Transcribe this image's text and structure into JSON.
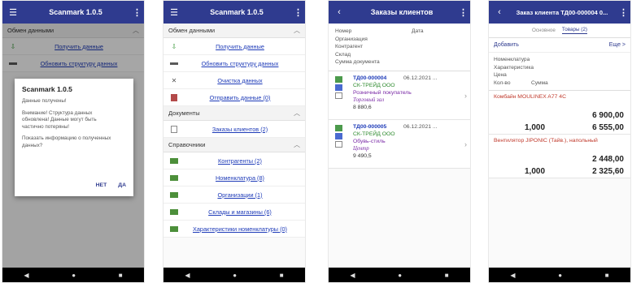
{
  "phone1": {
    "title": "Scanmark 1.0.5",
    "section": "Обмен данными",
    "rows": [
      {
        "label": "Получить данные"
      },
      {
        "label": "Обновить структуру данных"
      }
    ],
    "dialog": {
      "title": "Scanmark 1.0.5",
      "line1": "Данные получены!",
      "line2": "Внимание! Структура данных\nобновлена! Данные могут быть\nчастично потеряны!",
      "line3": "Показать информацию о полученных\nданных?",
      "no": "НЕТ",
      "yes": "ДА"
    }
  },
  "phone2": {
    "title": "Scanmark 1.0.5",
    "sections": [
      {
        "label": "Обмен данными",
        "items": [
          "Получить данные",
          "Обновить структуру данных",
          "Очистка данных",
          "Отправить данные (0)"
        ]
      },
      {
        "label": "Документы",
        "items": [
          "Заказы клиентов (2)"
        ]
      },
      {
        "label": "Справочники",
        "items": [
          "Контрагенты (2)",
          "Номенклатура (8)",
          "Организации (1)",
          "Склады и магазины (6)",
          "Характеристики номенклатуры (0)"
        ]
      }
    ]
  },
  "phone3": {
    "title": "Заказы клиентов",
    "header": {
      "number": "Номер",
      "date": "Дата",
      "org": "Организация",
      "contractor": "Контрагент",
      "warehouse": "Склад",
      "sum": "Сумма документа"
    },
    "orders": [
      {
        "number": "ТД00-000004",
        "date": "06.12.2021 ...",
        "org": "СК-ТРЕЙД ООО",
        "contractor": "Розничный покупатель",
        "warehouse": "Торговый зал",
        "sum": "8 880,6"
      },
      {
        "number": "ТД00-000005",
        "date": "06.12.2021 ...",
        "org": "СК-ТРЕЙД ООО",
        "contractor": "Обувь-стиль",
        "warehouse": "Центр",
        "sum": "9 490,5"
      }
    ]
  },
  "phone4": {
    "title": "Заказ клиента ТД00-000004 0...",
    "tabs": [
      "Основное",
      "Товары (2)"
    ],
    "add": "Добавить",
    "more": "Еще >",
    "cols": {
      "nom": "Номенклатура",
      "char": "Характеристика",
      "price": "Цена",
      "qty": "Кол-во",
      "sum": "Сумма"
    },
    "goods": [
      {
        "name": "Комбайн MOULINEX  A77 4C",
        "price": "6 900,00",
        "qty": "1,000",
        "sum": "6 555,00"
      },
      {
        "name": "Вентилятор JIPONIC (Тайв.), напольный",
        "price": "2 448,00",
        "qty": "1,000",
        "sum": "2 325,60"
      }
    ]
  },
  "colors": {
    "appbar": "#2f3b8f",
    "link": "#1e3bb8",
    "accentRed": "#c0392b"
  }
}
